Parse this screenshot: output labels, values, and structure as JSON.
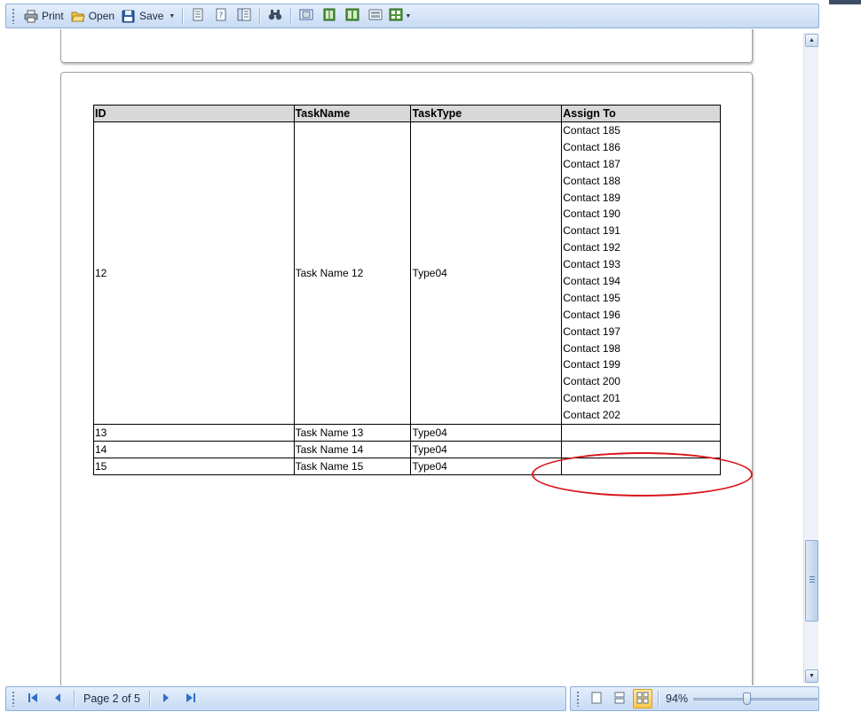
{
  "toolbar": {
    "print_label": "Print",
    "open_label": "Open",
    "save_label": "Save",
    "icons": [
      "page-setup-icon",
      "parameters-icon",
      "document-map-icon",
      "find-icon",
      "single-page-icon",
      "two-pages-icon",
      "facing-pages-icon",
      "thumbnails-icon",
      "export-icon"
    ]
  },
  "report": {
    "headers": [
      "ID",
      "TaskName",
      "TaskType",
      "Assign To"
    ],
    "row12": {
      "id": "12",
      "name": "Task Name 12",
      "type": "Type04",
      "contacts": [
        "Contact 185",
        "Contact 186",
        "Contact 187",
        "Contact 188",
        "Contact 189",
        "Contact 190",
        "Contact 191",
        "Contact 192",
        "Contact 193",
        "Contact 194",
        "Contact 195",
        "Contact 196",
        "Contact 197",
        "Contact 198",
        "Contact 199",
        "Contact 200",
        "Contact 201",
        "Contact 202"
      ]
    },
    "row13": {
      "id": "13",
      "name": "Task Name 13",
      "type": "Type04",
      "assign": ""
    },
    "row14": {
      "id": "14",
      "name": "Task Name 14",
      "type": "Type04",
      "assign": ""
    },
    "row15": {
      "id": "15",
      "name": "Task Name 15",
      "type": "Type04",
      "assign": ""
    }
  },
  "navigation": {
    "page_text": "Page 2 of 5"
  },
  "zoom": {
    "label": "94%",
    "level_fraction": 0.43
  },
  "colors": {
    "accent": "#c7dbf4",
    "annotation": "#d8161b",
    "header_fill": "#d8d8d8"
  }
}
